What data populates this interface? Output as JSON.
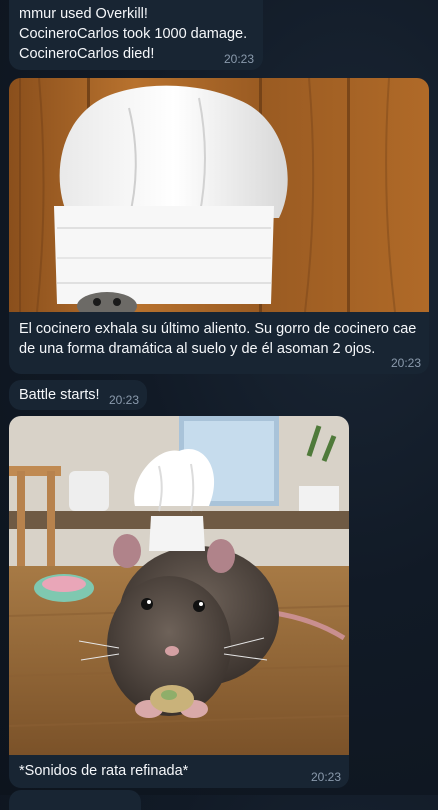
{
  "messages": [
    {
      "lines": [
        "mmur used Overkill!",
        "CocineroCarlos took 1000 damage.",
        "CocineroCarlos died!"
      ],
      "time": "20:23"
    },
    {
      "image": "chef-hat-on-floor-photo",
      "caption": "El cocinero exhala su último aliento. Su gorro de cocinero cae de una forma dramática al suelo y de él asoman 2 ojos.",
      "time": "20:23"
    },
    {
      "text": "Battle starts!",
      "time": "20:23"
    },
    {
      "image": "rat-wearing-chef-hat-photo",
      "caption": "*Sonidos de rata refinada*",
      "time": "20:23"
    }
  ],
  "colors": {
    "background": "#0f1722",
    "bubble": "#182533",
    "timestamp": "#8a9aac"
  }
}
